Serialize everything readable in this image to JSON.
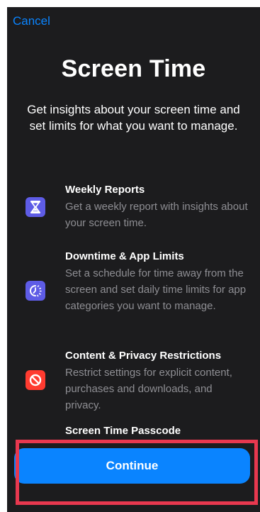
{
  "header": {
    "cancel_label": "Cancel"
  },
  "intro": {
    "title": "Screen Time",
    "subtitle": "Get insights about your screen time and set limits for what you want to manage."
  },
  "features": [
    {
      "icon": "hourglass-icon",
      "icon_color": "#5e5ce6",
      "title": "Weekly Reports",
      "description": "Get a weekly report with insights about your screen time."
    },
    {
      "icon": "downtime-icon",
      "icon_color": "#5e5ce6",
      "title": "Downtime & App Limits",
      "description": "Set a schedule for time away from the screen and set daily time limits for app categories you want to manage."
    },
    {
      "icon": "restriction-icon",
      "icon_color": "#ff3b30",
      "title": "Content & Privacy Restrictions",
      "description": "Restrict settings for explicit content, purchases and downloads, and privacy."
    },
    {
      "title": "Screen Time Passcode"
    }
  ],
  "footer": {
    "continue_label": "Continue"
  },
  "colors": {
    "background": "#1c1c1e",
    "accent": "#0a84ff",
    "highlight": "#e8384f"
  }
}
